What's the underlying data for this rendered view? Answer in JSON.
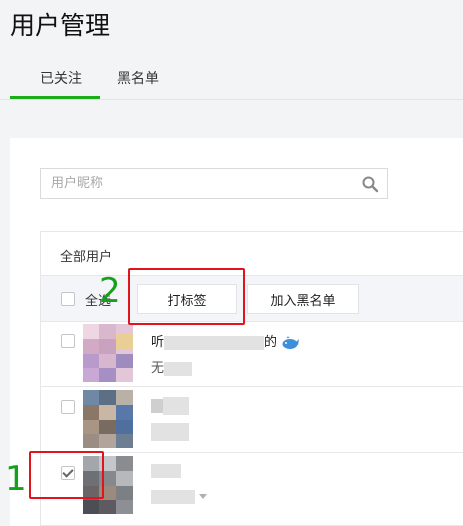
{
  "page": {
    "title": "用户管理"
  },
  "tabs": [
    {
      "label": "已关注",
      "active": true
    },
    {
      "label": "黑名单",
      "active": false
    }
  ],
  "search": {
    "placeholder": "用户昵称"
  },
  "table": {
    "group_label": "全部用户",
    "select_all_label": "全选",
    "buttons": {
      "tag": "打标签",
      "blacklist": "加入黑名单"
    },
    "rows": [
      {
        "name_prefix": "听",
        "name_suffix": "的",
        "emoji": "whale",
        "sub_prefix": "无",
        "checked": false
      },
      {
        "name_prefix": "",
        "name_suffix": "",
        "sub_prefix": "",
        "checked": false
      },
      {
        "name_prefix": "",
        "name_suffix": "",
        "sub_prefix": "",
        "checked": true
      }
    ]
  },
  "annotations": {
    "step1": "1",
    "step2": "2"
  },
  "colors": {
    "accent": "#1aad19",
    "annotation_red": "#e1141b",
    "annotation_green": "#16a11c"
  },
  "icons": {
    "search": "search-icon",
    "whale": "whale-emoji-icon",
    "dropdown": "caret-down-icon"
  }
}
